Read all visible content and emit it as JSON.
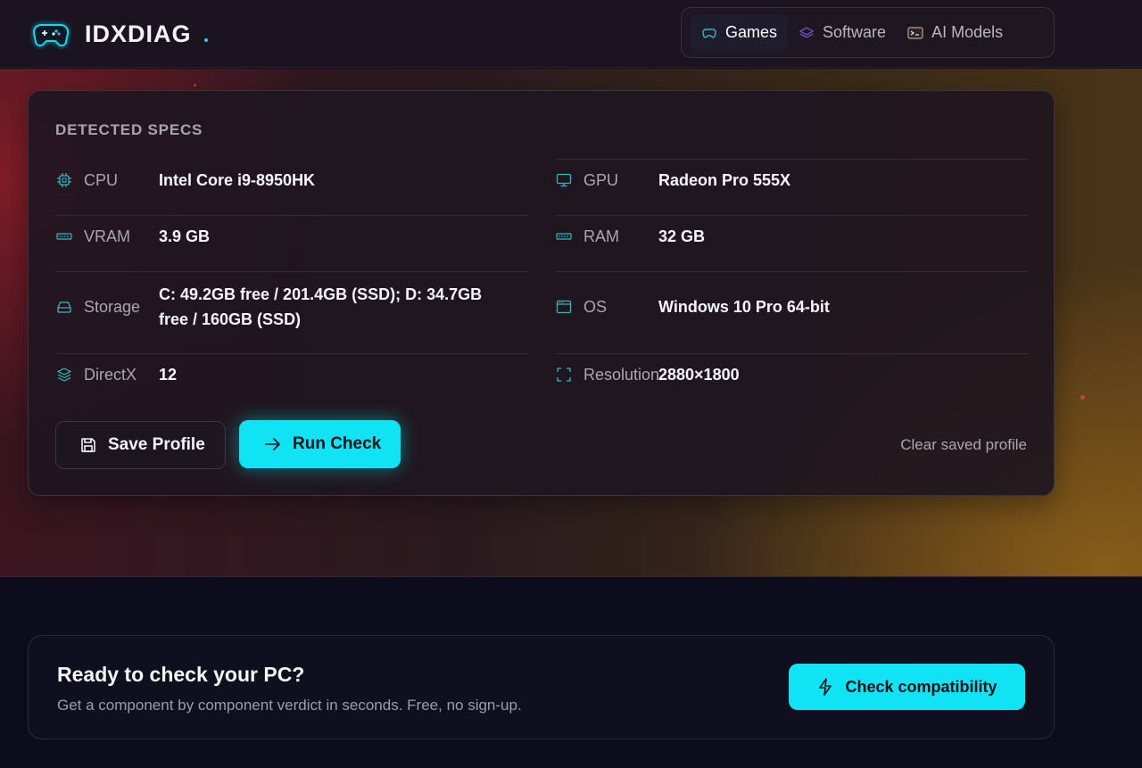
{
  "brand": {
    "name": "IDXDIAG",
    "icon": "gamepad-icon",
    "accent": "#12d8f0"
  },
  "nav": {
    "items": [
      {
        "label": "Games",
        "icon": "gamepad-icon",
        "active": true
      },
      {
        "label": "Software",
        "icon": "layers-icon",
        "active": false
      },
      {
        "label": "AI Models",
        "icon": "terminal-icon",
        "active": false
      }
    ]
  },
  "specs": {
    "title": "DETECTED SPECS",
    "cpu": {
      "label": "CPU",
      "value": "Intel Core i9-8950HK",
      "icon": "cpu-icon"
    },
    "gpu": {
      "label": "GPU",
      "value": "Radeon Pro 555X",
      "icon": "monitor-icon"
    },
    "vram": {
      "label": "VRAM",
      "value": "3.9 GB",
      "icon": "memory-icon"
    },
    "ram": {
      "label": "RAM",
      "value": "32 GB",
      "icon": "memory-icon"
    },
    "storage": {
      "label": "Storage",
      "value": "C: 49.2GB free / 201.4GB (SSD); D: 34.7GB free / 160GB (SSD)",
      "icon": "drive-icon"
    },
    "os": {
      "label": "OS",
      "value": "Windows 10 Pro 64-bit",
      "icon": "window-icon"
    },
    "directx": {
      "label": "DirectX",
      "value": "12",
      "icon": "layers-icon"
    },
    "resolution": {
      "label": "Resolution",
      "value": "2880×1800",
      "icon": "fullscreen-icon"
    }
  },
  "actions": {
    "save_label": "Save Profile",
    "run_label": "Run Check",
    "clear_label": "Clear saved profile"
  },
  "cta": {
    "title": "Ready to check your PC?",
    "subtitle": "Get a component by component verdict in seconds. Free, no sign-up.",
    "button_label": "Check compatibility"
  },
  "colors": {
    "primary": "#10e4f4",
    "background": "#0c0c1a",
    "card": "#1e161e"
  }
}
